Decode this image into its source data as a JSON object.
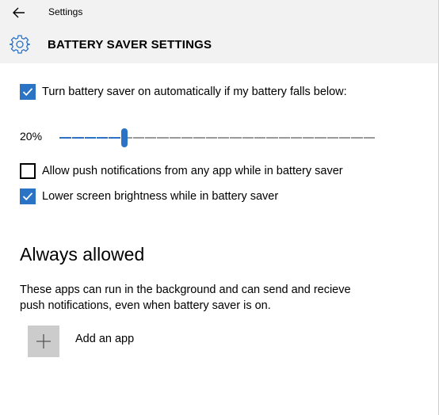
{
  "window": {
    "app_title": "Settings"
  },
  "header": {
    "page_title": "BATTERY SAVER SETTINGS"
  },
  "auto_saver": {
    "label": "Turn battery saver on automatically if my battery falls below:",
    "checked": true
  },
  "threshold": {
    "value_label": "20%",
    "value_fraction": 0.2
  },
  "push_notifications": {
    "label": "Allow push notifications from any app while in battery saver",
    "checked": false
  },
  "lower_brightness": {
    "label": "Lower screen brightness while in battery saver",
    "checked": true
  },
  "always_allowed": {
    "title": "Always allowed",
    "description": "These apps can run in the background and can send and recieve push notifications, even when battery saver is on.",
    "add_app_label": "Add an app"
  },
  "colors": {
    "accent": "#2a73c5",
    "header_bg": "#f2f2f2",
    "add_button_bg": "#cccccc"
  },
  "icons": {
    "back": "back-arrow-icon",
    "settings": "gear-icon",
    "add": "plus-icon",
    "check": "checkmark-icon"
  }
}
